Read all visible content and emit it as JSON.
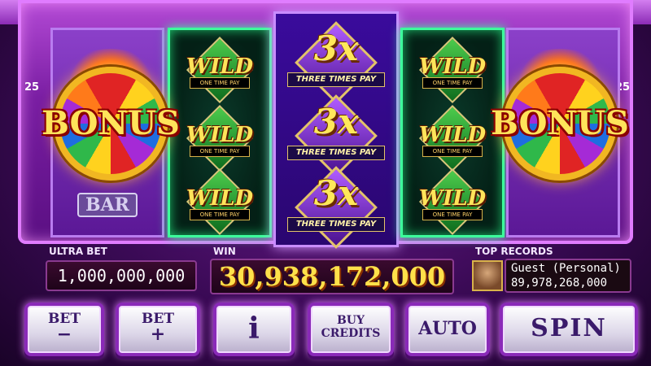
{
  "side_numbers": {
    "left": "25",
    "right": "25"
  },
  "symbols": {
    "wild": "WILD",
    "wild_sub": "ONE TIME PAY",
    "three": "3x",
    "three_sub": "THREE TIMES PAY",
    "bonus": "BONUS",
    "bar": "BAR"
  },
  "meters": {
    "ultra_bet_label": "ULTRA BET",
    "ultra_bet_value": "1,000,000,000",
    "win_label": "WIN",
    "win_value": "30,938,172,000",
    "top_records_label": "TOP RECORDS",
    "record_name": "Guest (Personal)",
    "record_value": "89,978,268,000"
  },
  "buttons": {
    "bet_minus": {
      "label": "BET",
      "symbol": "−"
    },
    "bet_plus": {
      "label": "BET",
      "symbol": "+"
    },
    "info": "i",
    "buy_credits_1": "BUY",
    "buy_credits_2": "CREDITS",
    "auto": "AUTO",
    "spin": "SPIN"
  },
  "colors": {
    "accent": "#b44ad6",
    "win_gold": "#ffe14a",
    "reel_green": "#3dff9c"
  }
}
